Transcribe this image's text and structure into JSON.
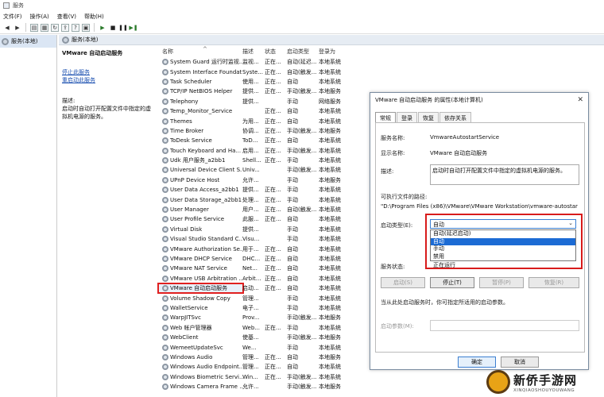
{
  "window": {
    "title": "服务"
  },
  "menu": [
    "文件(F)",
    "操作(A)",
    "查看(V)",
    "帮助(H)"
  ],
  "tree": {
    "root": "服务(本地)"
  },
  "main": {
    "header": "服务(本地)"
  },
  "desc": {
    "service_name": "VMware 自动启动服务",
    "link_stop": "停止此服务",
    "link_restart": "重启动此服务",
    "desc_label": "描述:",
    "desc_text": "启动时自动打开配置文件中指定的虚拟机电源的服务。"
  },
  "columns": {
    "name": "名称",
    "desc": "描述",
    "status": "状态",
    "startup": "启动类型",
    "logon": "登录为"
  },
  "rows": [
    {
      "name": "System Guard 运行时监视...",
      "desc": "监视...",
      "status": "正在...",
      "startup": "自动(延迟...",
      "logon": "本地系统"
    },
    {
      "name": "System Interface Foundat...",
      "desc": "Syste...",
      "status": "正在...",
      "startup": "自动(触发...",
      "logon": "本地系统"
    },
    {
      "name": "Task Scheduler",
      "desc": "使用...",
      "status": "正在...",
      "startup": "自动",
      "logon": "本地系统"
    },
    {
      "name": "TCP/IP NetBIOS Helper",
      "desc": "提供...",
      "status": "正在...",
      "startup": "手动(触发...",
      "logon": "本地服务"
    },
    {
      "name": "Telephony",
      "desc": "提供...",
      "status": "",
      "startup": "手动",
      "logon": "网络服务"
    },
    {
      "name": "Temp_Monitor_Service",
      "desc": "",
      "status": "正在...",
      "startup": "自动",
      "logon": "本地系统"
    },
    {
      "name": "Themes",
      "desc": "为用...",
      "status": "正在...",
      "startup": "自动",
      "logon": "本地系统"
    },
    {
      "name": "Time Broker",
      "desc": "协调...",
      "status": "正在...",
      "startup": "手动(触发...",
      "logon": "本地服务"
    },
    {
      "name": "ToDesk Service",
      "desc": "ToD...",
      "status": "正在...",
      "startup": "自动",
      "logon": "本地系统"
    },
    {
      "name": "Touch Keyboard and Ha...",
      "desc": "启用...",
      "status": "正在...",
      "startup": "手动(触发...",
      "logon": "本地系统"
    },
    {
      "name": "Udk 用户服务_a2bb1",
      "desc": "Shell...",
      "status": "正在...",
      "startup": "手动",
      "logon": "本地系统"
    },
    {
      "name": "Universal Device Client S...",
      "desc": "Univ...",
      "status": "",
      "startup": "手动(触发...",
      "logon": "本地系统"
    },
    {
      "name": "UPnP Device Host",
      "desc": "允许...",
      "status": "",
      "startup": "手动",
      "logon": "本地服务"
    },
    {
      "name": "User Data Access_a2bb1",
      "desc": "提供...",
      "status": "正在...",
      "startup": "手动",
      "logon": "本地系统"
    },
    {
      "name": "User Data Storage_a2bb1",
      "desc": "处理...",
      "status": "正在...",
      "startup": "手动",
      "logon": "本地系统"
    },
    {
      "name": "User Manager",
      "desc": "用户...",
      "status": "正在...",
      "startup": "自动(触发...",
      "logon": "本地系统"
    },
    {
      "name": "User Profile Service",
      "desc": "此服...",
      "status": "正在...",
      "startup": "自动",
      "logon": "本地系统"
    },
    {
      "name": "Virtual Disk",
      "desc": "提供...",
      "status": "",
      "startup": "手动",
      "logon": "本地系统"
    },
    {
      "name": "Visual Studio Standard C...",
      "desc": "Visu...",
      "status": "",
      "startup": "手动",
      "logon": "本地系统"
    },
    {
      "name": "VMware Authorization Se...",
      "desc": "用于...",
      "status": "正在...",
      "startup": "自动",
      "logon": "本地系统"
    },
    {
      "name": "VMware DHCP Service",
      "desc": "DHC...",
      "status": "正在...",
      "startup": "自动",
      "logon": "本地系统"
    },
    {
      "name": "VMware NAT Service",
      "desc": "Net...",
      "status": "正在...",
      "startup": "自动",
      "logon": "本地系统"
    },
    {
      "name": "VMware USB Arbitration ...",
      "desc": "Arbit...",
      "status": "正在...",
      "startup": "自动",
      "logon": "本地系统"
    },
    {
      "name": "VMware 自动启动服务",
      "desc": "启动...",
      "status": "正在...",
      "startup": "自动",
      "logon": "本地系统",
      "selected": true
    },
    {
      "name": "Volume Shadow Copy",
      "desc": "管理...",
      "status": "",
      "startup": "手动",
      "logon": "本地系统"
    },
    {
      "name": "WalletService",
      "desc": "电子...",
      "status": "",
      "startup": "手动",
      "logon": "本地系统"
    },
    {
      "name": "WarpJITSvc",
      "desc": "Prov...",
      "status": "",
      "startup": "手动(触发...",
      "logon": "本地服务"
    },
    {
      "name": "Web 帐户管理器",
      "desc": "Web...",
      "status": "正在...",
      "startup": "手动",
      "logon": "本地系统"
    },
    {
      "name": "WebClient",
      "desc": "使基...",
      "status": "",
      "startup": "手动(触发...",
      "logon": "本地服务"
    },
    {
      "name": "WemeetUpdateSvc",
      "desc": "We...",
      "status": "",
      "startup": "手动",
      "logon": "本地系统"
    },
    {
      "name": "Windows Audio",
      "desc": "管理...",
      "status": "正在...",
      "startup": "自动",
      "logon": "本地服务"
    },
    {
      "name": "Windows Audio Endpoint...",
      "desc": "管理...",
      "status": "正在...",
      "startup": "自动",
      "logon": "本地系统"
    },
    {
      "name": "Windows Biometric Servi...",
      "desc": "Win...",
      "status": "正在...",
      "startup": "手动(触发...",
      "logon": "本地系统"
    },
    {
      "name": "Windows Camera Frame ...",
      "desc": "允许...",
      "status": "",
      "startup": "手动(触发...",
      "logon": "本地服务"
    }
  ],
  "dialog": {
    "title": "VMware 自动启动服务 的属性(本地计算机)",
    "tabs": [
      "常规",
      "登录",
      "恢复",
      "依存关系"
    ],
    "service_name_label": "服务名称:",
    "service_name": "VmwareAutostartService",
    "display_name_label": "显示名称:",
    "display_name": "VMware 自动启动服务",
    "desc_label": "描述:",
    "desc": "启动时自动打开配置文件中指定的虚拟机电源的服务。",
    "path_label": "可执行文件的路径:",
    "path": "\"D:\\Program Files (x86)\\VMware\\VMware Workstation\\vmware-autostar",
    "startup_label": "启动类型(E):",
    "startup_value": "自动",
    "startup_options": [
      "自动(延迟启动)",
      "自动",
      "手动",
      "禁用"
    ],
    "status_label": "服务状态:",
    "status_value": "正在运行",
    "btn_start": "启动(S)",
    "btn_stop": "停止(T)",
    "btn_pause": "暂停(P)",
    "btn_resume": "恢复(R)",
    "hint": "当从此处启动服务时，你可指定所适用的启动参数。",
    "param_label": "启动参数(M):",
    "ok": "确定",
    "cancel": "取消"
  },
  "watermark": {
    "title": "新侨手游网",
    "sub": "XINQIAOSHOUYOUWANG"
  }
}
